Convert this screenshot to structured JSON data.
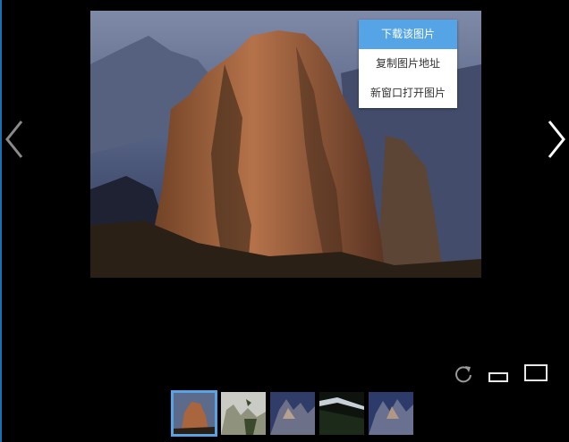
{
  "context_menu": {
    "items": [
      {
        "label": "下载该图片",
        "active": true
      },
      {
        "label": "复制图片地址",
        "active": false
      },
      {
        "label": "新窗口打开图片",
        "active": false
      }
    ]
  },
  "toolbar": {
    "rotate_icon": "rotate-icon",
    "fit_icon": "actual-size-icon",
    "fullscreen_icon": "fullscreen-icon"
  },
  "thumbnails": {
    "count": 5,
    "selected_index": 0
  },
  "colors": {
    "accent": "#55a4e6",
    "background": "#000000"
  }
}
